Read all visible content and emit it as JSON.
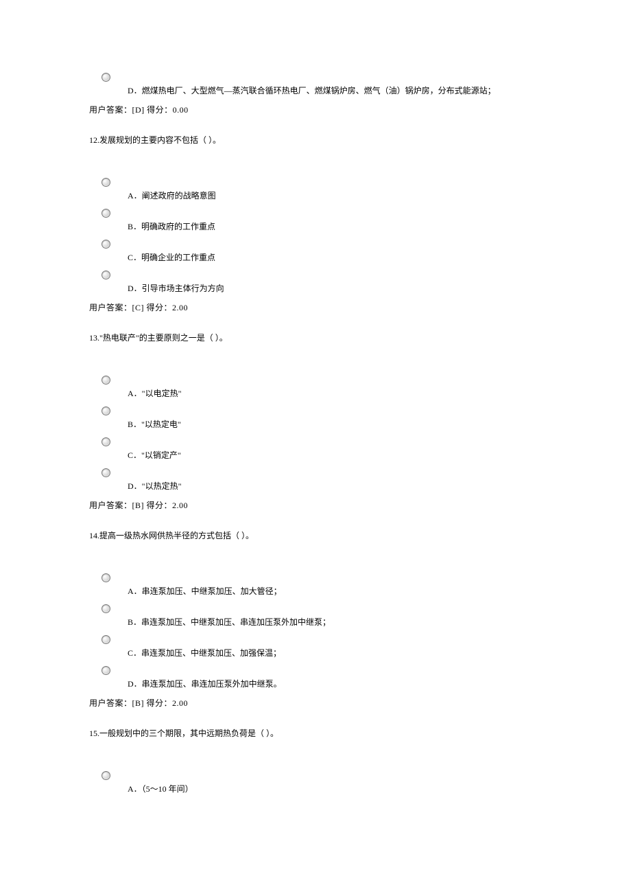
{
  "q11": {
    "options": {
      "D": "D．燃煤热电厂、大型燃气—蒸汽联合循环热电厂、燃煤锅炉房、燃气（油）锅炉房，分布式能源站；"
    },
    "answer": "用户答案：[D]   得分：0.00"
  },
  "q12": {
    "title": "12.发展规划的主要内容不包括（  ）。",
    "options": {
      "A": "A．阐述政府的战略意图",
      "B": "B．明确政府的工作重点",
      "C": "C．明确企业的工作重点",
      "D": "D．引导市场主体行为方向"
    },
    "answer": "用户答案：[C]   得分：2.00"
  },
  "q13": {
    "title": "13.\"热电联产\"的主要原则之一是（  ）。",
    "options": {
      "A": "A．\"以电定热\"",
      "B": "B．\"以热定电\"",
      "C": "C．\"以销定产\"",
      "D": "D．\"以热定热\""
    },
    "answer": "用户答案：[B]   得分：2.00"
  },
  "q14": {
    "title": "14.提高一级热水网供热半径的方式包括（  ）。",
    "options": {
      "A": "A．串连泵加压、中继泵加压、加大管径；",
      "B": "B．串连泵加压、中继泵加压、串连加压泵外加中继泵；",
      "C": "C．串连泵加压、中继泵加压、加强保温；",
      "D": "D．串连泵加压、串连加压泵外加中继泵。"
    },
    "answer": "用户答案：[B]   得分：2.00"
  },
  "q15": {
    "title": "15.一般规划中的三个期限，其中远期热负荷是（ ）。",
    "options": {
      "A": "A．（5～10 年间）"
    }
  }
}
